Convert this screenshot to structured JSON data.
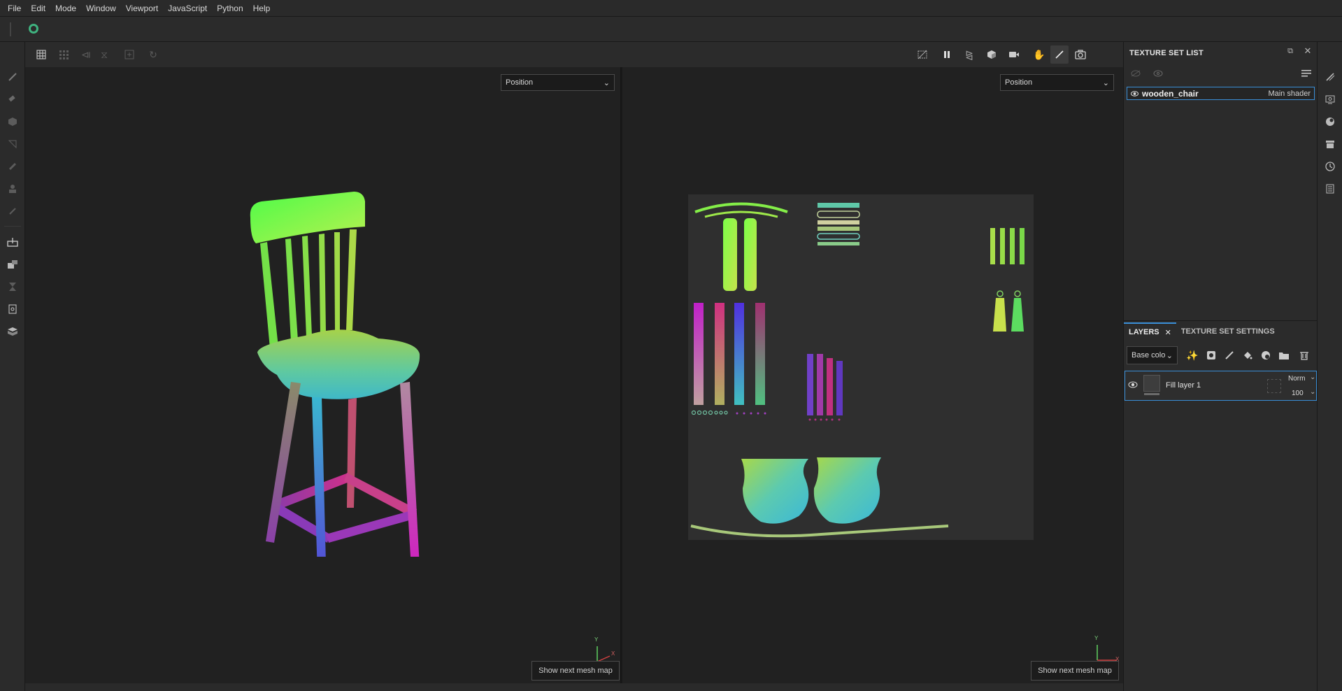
{
  "menu": [
    "File",
    "Edit",
    "Mode",
    "Window",
    "Viewport",
    "JavaScript",
    "Python",
    "Help"
  ],
  "viewport3d": {
    "channel": "Position",
    "next_button": "Show next mesh map",
    "axis_y": "Y",
    "axis_x": "X"
  },
  "viewport2d": {
    "channel": "Position",
    "next_button": "Show next mesh map",
    "axis_y": "Y",
    "axis_x": "X"
  },
  "texture_set_list": {
    "title": "TEXTURE SET LIST",
    "item_name": "wooden_chair",
    "item_shader": "Main shader"
  },
  "layers": {
    "tab_layers": "LAYERS",
    "tab_settings": "TEXTURE SET SETTINGS",
    "channel": "Base colo",
    "layer_name": "Fill layer 1",
    "blend_mode": "Norm",
    "opacity": "100"
  },
  "colors": {
    "accent": "#3a8fd8",
    "panel": "#2b2b2b",
    "viewport": "#212121"
  }
}
